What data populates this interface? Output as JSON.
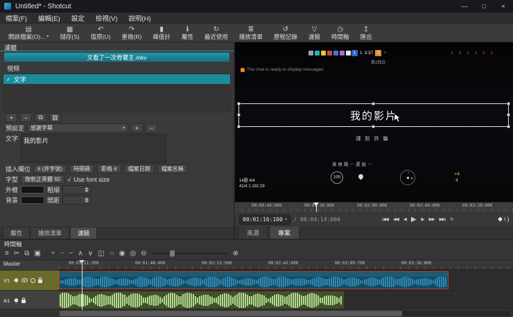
{
  "ui": {
    "caret_down": "▾"
  },
  "window": {
    "title": "Untitled* - Shotcut",
    "minimize_glyph": "—",
    "maximize_glyph": "□",
    "close_glyph": "×"
  },
  "menubar": {
    "items": [
      "檔案(F)",
      "編輯(E)",
      "設定",
      "檢視(V)",
      "說明(H)"
    ]
  },
  "toolbar": {
    "items": [
      {
        "name": "open-file",
        "glyph": "▤",
        "label": "開啟檔案(O)..."
      },
      {
        "name": "save",
        "glyph": "▦",
        "label": "儲存(S)"
      },
      {
        "name": "undo",
        "glyph": "↶",
        "label": "復原(U)"
      },
      {
        "name": "redo",
        "glyph": "↷",
        "label": "重做(R)"
      },
      {
        "name": "peak-meter",
        "glyph": "▮",
        "label": "峰值計"
      },
      {
        "name": "properties",
        "glyph": "ℹ",
        "label": "屬性"
      },
      {
        "name": "recent",
        "glyph": "↻",
        "label": "最近使用"
      },
      {
        "name": "playlist",
        "glyph": "≣",
        "label": "播放清單"
      },
      {
        "name": "history",
        "glyph": "↺",
        "label": "歷程記錄"
      },
      {
        "name": "filters",
        "glyph": "▽",
        "label": "濾鏡"
      },
      {
        "name": "timeline",
        "glyph": "◷",
        "label": "時間軸"
      },
      {
        "name": "export",
        "glyph": "↥",
        "label": "匯出"
      }
    ]
  },
  "filters": {
    "dock_title": "濾鏡",
    "clip_name": "文看了一次骨鷺主.mkv",
    "group_label": "視頻",
    "filter_check": "✓",
    "filter_name": "文字",
    "action_glyphs": {
      "add": "+",
      "remove": "−",
      "copy": "⧉",
      "save": "▥"
    },
    "preset_label": "預設定",
    "preset_value": "感謝字幕",
    "preset_add": "+",
    "preset_remove": "−",
    "text_label": "文字",
    "text_value": "我的影片",
    "insert_label": "插入欄位",
    "insert_buttons": [
      "# (井字號)",
      "時間碼",
      "影格 #",
      "檔案日期",
      "檔案名稱"
    ],
    "font_label": "字型",
    "font_value": "微軟正黑體 60",
    "font_size_check": "√",
    "font_size_label": "Use font size",
    "outline_label": "外框",
    "thickness_label": "粗細",
    "background_label": "背景",
    "spacing_label": "間距",
    "dock_tabs": [
      "屬性",
      "播放清單",
      "濾鏡"
    ],
    "active_dock_tab": "濾鏡"
  },
  "preview": {
    "overlay": {
      "score_left": "1",
      "score_mid": "1",
      "clock": "3:37",
      "score_right": "0",
      "close_glyph": "×",
      "red_digits": "1 0 1 1 0 1",
      "round_label": "第2回合",
      "chat_message": "The chat is ready to display messages",
      "title_text": "我的影片",
      "warning_text": "謹防詐騙",
      "mode_text": "資格戰－選拔－",
      "hud_value": "100",
      "mark_top": "+4",
      "mark_bottom": "4",
      "stat_line1": "14圈 4/4",
      "stat_line2": "41/4 1:192:29"
    },
    "ruler_ticks": [
      "00:00:40:000",
      "00:01:20:000",
      "00:02:00:000",
      "00:02:40:000",
      "00:03:20:000"
    ],
    "position": "00:01:16:100",
    "duration": "/ 00:04:14:004",
    "transport": [
      {
        "name": "skip-to-start",
        "glyph": "|◀◀"
      },
      {
        "name": "rewind",
        "glyph": "◀◀"
      },
      {
        "name": "step-back",
        "glyph": "◀"
      },
      {
        "name": "play",
        "glyph": "▶"
      },
      {
        "name": "step-forward",
        "glyph": "▶"
      },
      {
        "name": "fast-forward",
        "glyph": "▶▶"
      },
      {
        "name": "skip-to-end",
        "glyph": "▶▶|"
      },
      {
        "name": "loop",
        "glyph": "↻"
      }
    ],
    "tabs": [
      "來源",
      "專案"
    ],
    "active_tab": "專案"
  },
  "timeline": {
    "dock_title": "時間軸",
    "toolbar": [
      {
        "name": "timeline-menu",
        "glyph": "≡"
      },
      {
        "name": "cut",
        "glyph": "✂"
      },
      {
        "name": "copy",
        "glyph": "⧉"
      },
      {
        "name": "paste",
        "glyph": "▣"
      },
      {
        "name": "append",
        "glyph": "+"
      },
      {
        "name": "ripple-delete",
        "glyph": "−"
      },
      {
        "name": "lift",
        "glyph": "~"
      },
      {
        "name": "overwrite",
        "glyph": "∧"
      },
      {
        "name": "split",
        "glyph": "∨"
      },
      {
        "name": "markers",
        "glyph": "◫"
      },
      {
        "name": "snap",
        "glyph": "∩"
      },
      {
        "name": "scrub-while-dragging",
        "glyph": "◉"
      },
      {
        "name": "ripple",
        "glyph": "◎"
      },
      {
        "name": "zoom-out",
        "glyph": "⊖"
      },
      {
        "name": "zoom-in",
        "glyph": "⊕"
      }
    ],
    "master_label": "Master",
    "ruler_ticks": [
      "00:01:21:300",
      "00:01:48:400",
      "00:02:15:500",
      "00:02:42:600",
      "00:03:09:700",
      "00:03:36:800"
    ],
    "tracks": [
      {
        "name": "V1"
      },
      {
        "name": "A1"
      }
    ]
  }
}
